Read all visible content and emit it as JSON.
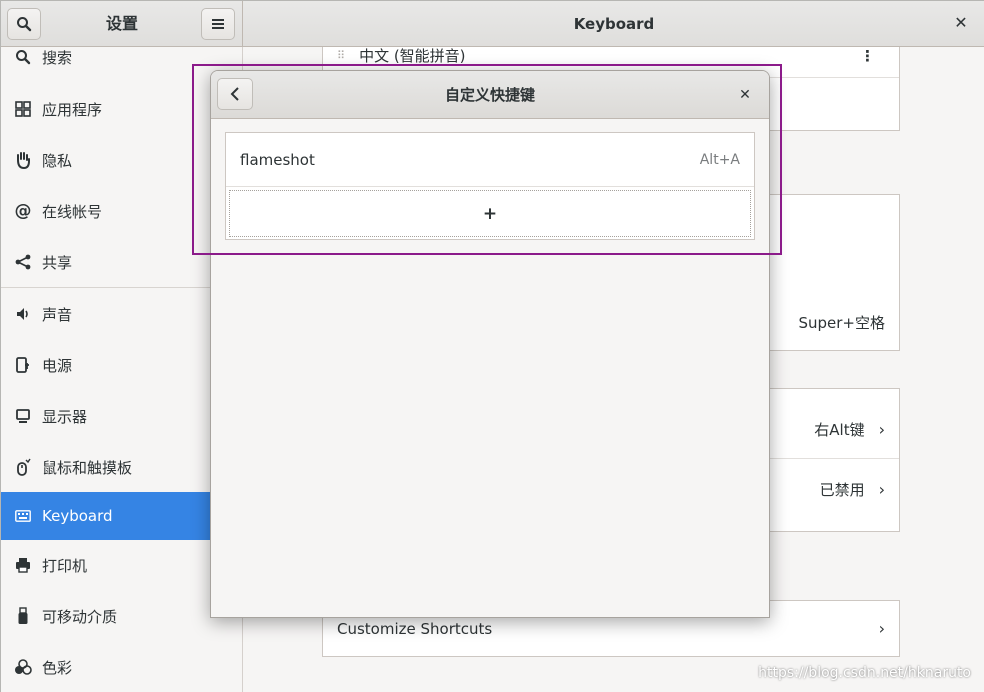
{
  "sidebar": {
    "title": "设置",
    "items": [
      {
        "label": "搜索",
        "icon": "search-icon"
      },
      {
        "label": "应用程序",
        "icon": "apps-grid-icon"
      },
      {
        "label": "隐私",
        "icon": "hand-icon"
      },
      {
        "label": "在线帐号",
        "icon": "at-icon"
      },
      {
        "label": "共享",
        "icon": "share-icon"
      },
      {
        "label": "声音",
        "icon": "speaker-icon"
      },
      {
        "label": "电源",
        "icon": "power-icon"
      },
      {
        "label": "显示器",
        "icon": "display-icon"
      },
      {
        "label": "鼠标和触摸板",
        "icon": "mouse-icon"
      },
      {
        "label": "Keyboard",
        "icon": "keyboard-icon"
      },
      {
        "label": "打印机",
        "icon": "printer-icon"
      },
      {
        "label": "可移动介质",
        "icon": "usb-icon"
      },
      {
        "label": "色彩",
        "icon": "color-icon"
      }
    ]
  },
  "header": {
    "title": "Keyboard"
  },
  "main": {
    "input_source": "中文 (智能拼音)",
    "switch_shortcut": "Super+空格",
    "alt_char_key": "右Alt键",
    "compose_key": "已禁用",
    "customize_shortcuts": "Customize Shortcuts"
  },
  "dialog": {
    "title": "自定义快捷键",
    "shortcuts": [
      {
        "name": "flameshot",
        "accel": "Alt+A"
      }
    ],
    "add_label": "+"
  },
  "watermark": "https://blog.csdn.net/hknaruto",
  "colors": {
    "accent": "#3584e4",
    "highlight_box": "#8b1a8a"
  }
}
